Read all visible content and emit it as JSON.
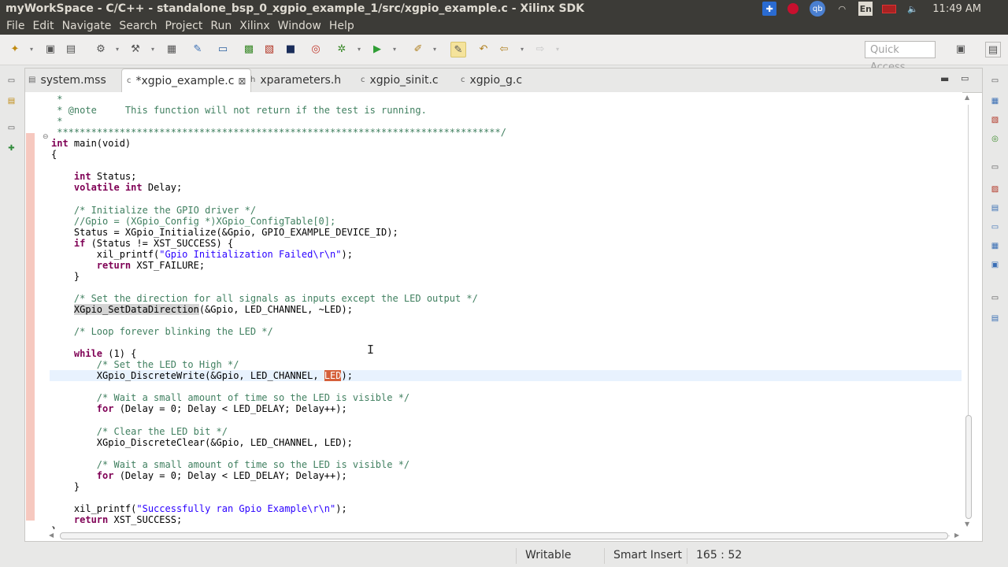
{
  "window": {
    "title": "myWorkSpace - C/C++ - standalone_bsp_0_xgpio_example_1/src/xgpio_example.c - Xilinx SDK"
  },
  "tray": {
    "lang": "En",
    "clock": "11:49 AM",
    "user_initials": "qb"
  },
  "menu": [
    "File",
    "Edit",
    "Navigate",
    "Search",
    "Project",
    "Run",
    "Xilinx",
    "Window",
    "Help"
  ],
  "toolbar": {
    "quick_access_placeholder": "Quick Access"
  },
  "tabs": [
    {
      "label": "system.mss",
      "active": false
    },
    {
      "label": "*xgpio_example.c",
      "active": true
    },
    {
      "label": "xparameters.h",
      "active": false
    },
    {
      "label": "xgpio_sinit.c",
      "active": false
    },
    {
      "label": "xgpio_g.c",
      "active": false
    }
  ],
  "code": {
    "lines": [
      " *",
      " * @note     This function will not return if the test is running.",
      " *",
      " ******************************************************************************/",
      "int main(void)",
      "{",
      "",
      "    int Status;",
      "    volatile int Delay;",
      "",
      "    /* Initialize the GPIO driver */",
      "    //Gpio = (XGpio_Config *)XGpio_ConfigTable[0];",
      "    Status = XGpio_Initialize(&Gpio, GPIO_EXAMPLE_DEVICE_ID);",
      "    if (Status != XST_SUCCESS) {",
      "        xil_printf(\"Gpio Initialization Failed\\r\\n\");",
      "        return XST_FAILURE;",
      "    }",
      "",
      "    /* Set the direction for all signals as inputs except the LED output */",
      "    XGpio_SetDataDirection(&Gpio, LED_CHANNEL, ~LED);",
      "",
      "    /* Loop forever blinking the LED */",
      "",
      "    while (1) {",
      "        /* Set the LED to High */",
      "        XGpio_DiscreteWrite(&Gpio, LED_CHANNEL, LED);",
      "",
      "        /* Wait a small amount of time so the LED is visible */",
      "        for (Delay = 0; Delay < LED_DELAY; Delay++);",
      "",
      "        /* Clear the LED bit */",
      "        XGpio_DiscreteClear(&Gpio, LED_CHANNEL, LED);",
      "",
      "        /* Wait a small amount of time so the LED is visible */",
      "        for (Delay = 0; Delay < LED_DELAY; Delay++);",
      "    }",
      "",
      "    xil_printf(\"Successfully ran Gpio Example\\r\\n\");",
      "    return XST_SUCCESS;",
      "}"
    ],
    "current_line_index": 25
  },
  "status": {
    "mode": "Writable",
    "insert": "Smart Insert",
    "position": "165 : 52"
  }
}
